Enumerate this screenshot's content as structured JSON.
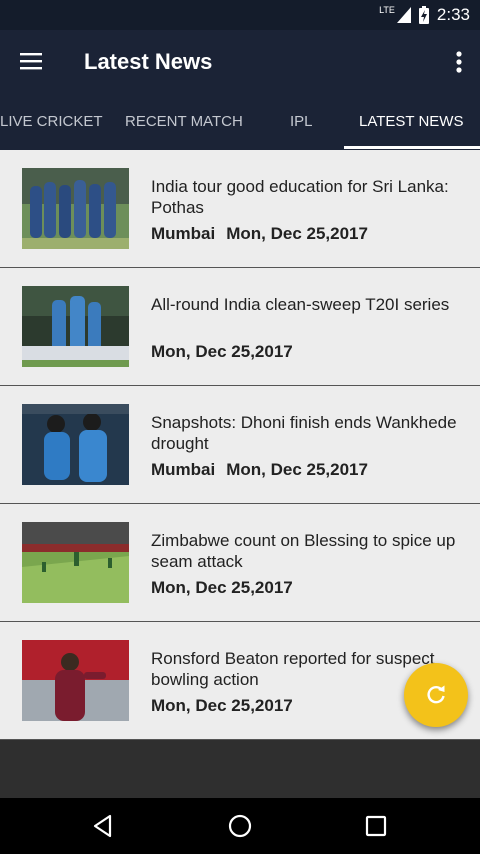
{
  "status_bar": {
    "network": "LTE",
    "time": "2:33"
  },
  "app_bar": {
    "title": "Latest News",
    "menu_icon": "hamburger-menu-icon",
    "overflow_icon": "more-vert-icon"
  },
  "tabs": [
    {
      "label": "LIVE CRICKET"
    },
    {
      "label": "RECENT MATCH"
    },
    {
      "label": "IPL"
    },
    {
      "label": "LATEST NEWS",
      "active": true
    }
  ],
  "news": [
    {
      "headline": "India tour good education for Sri Lanka: Pothas",
      "location": "Mumbai",
      "date": "Mon, Dec 25,2017"
    },
    {
      "headline": "All-round India clean-sweep T20I series",
      "location": "",
      "date": "Mon, Dec 25,2017"
    },
    {
      "headline": "Snapshots: Dhoni finish ends Wankhede drought",
      "location": "Mumbai",
      "date": "Mon, Dec 25,2017"
    },
    {
      "headline": "Zimbabwe count on Blessing to spice up seam attack",
      "location": "",
      "date": "Mon, Dec 25,2017"
    },
    {
      "headline": "Ronsford Beaton reported for suspect bowling action",
      "location": "",
      "date": "Mon, Dec 25,2017"
    }
  ],
  "fab": {
    "icon": "refresh-icon",
    "color": "#f3c21a"
  },
  "colors": {
    "app_bar": "#1b2336",
    "status_bar": "#141c2b",
    "list_bg": "#ededed"
  }
}
